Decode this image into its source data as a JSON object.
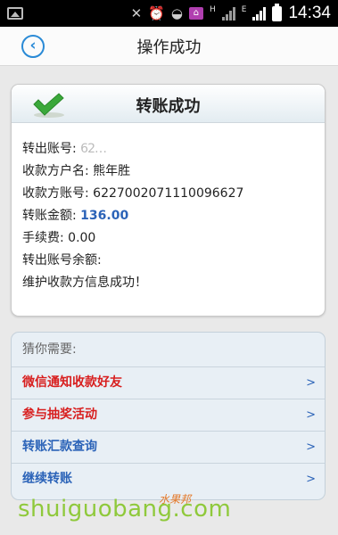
{
  "status_bar": {
    "time": "14:34",
    "net_letter_1": "H",
    "net_letter_2": "E"
  },
  "header": {
    "title": "操作成功",
    "back_icon": "chevron-left-icon"
  },
  "result": {
    "title": "转账成功",
    "success_icon": "checkmark-icon",
    "lines": {
      "from_account_label": "转出账号:",
      "from_account_value": "62…",
      "payee_name": "收款方户名: 熊年胜",
      "payee_account": "收款方账号: 6227002071110096627",
      "amount_label": "转账金额: ",
      "amount_value": "136.00",
      "fee": "手续费: 0.00",
      "balance": "转出账号余额:",
      "message": "维护收款方信息成功！"
    }
  },
  "suggestions": {
    "heading": "猜你需要:",
    "items": [
      {
        "label": "微信通知收款好友",
        "color": "#d81e1e"
      },
      {
        "label": "参与抽奖活动",
        "color": "#d81e1e"
      },
      {
        "label": "转账汇款查询",
        "color": "#2b63b8"
      },
      {
        "label": "继续转账",
        "color": "#2b63b8"
      }
    ],
    "chevron": ">"
  },
  "watermark": {
    "text": "shuiguobang.com",
    "cn": "水果邦"
  }
}
